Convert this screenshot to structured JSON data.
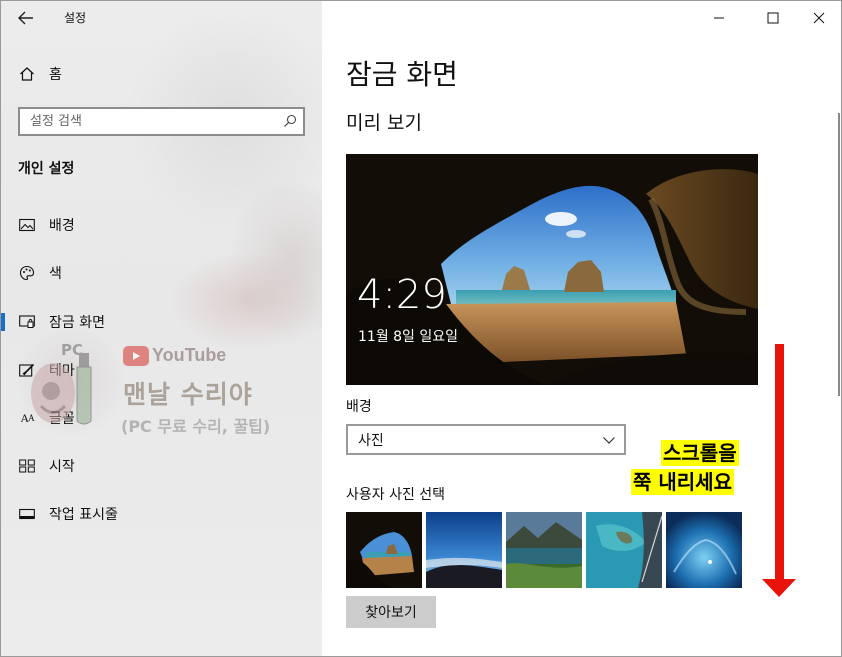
{
  "window": {
    "app_title": "설정",
    "back_icon": "back-arrow-icon",
    "controls": {
      "minimize": "minimize-icon",
      "maximize": "maximize-icon",
      "close": "close-icon"
    }
  },
  "sidebar": {
    "home_label": "홈",
    "search_placeholder": "설정 검색",
    "section_title": "개인 설정",
    "items": [
      {
        "label": "배경",
        "icon": "picture-icon",
        "active": false
      },
      {
        "label": "색",
        "icon": "palette-icon",
        "active": false
      },
      {
        "label": "잠금 화면",
        "icon": "lock-screen-icon",
        "active": true
      },
      {
        "label": "테마",
        "icon": "theme-brush-icon",
        "active": false
      },
      {
        "label": "글꼴",
        "icon": "font-icon",
        "active": false
      },
      {
        "label": "시작",
        "icon": "start-grid-icon",
        "active": false
      },
      {
        "label": "작업 표시줄",
        "icon": "taskbar-icon",
        "active": false
      }
    ],
    "accent_color": "#1a6dc8"
  },
  "watermark": {
    "pc": "PC",
    "youtube": "YouTube",
    "main": "맨날 수리야",
    "sub": "(PC 무료 수리, 꿀팁)"
  },
  "main": {
    "page_title": "잠금 화면",
    "preview_heading": "미리 보기",
    "preview_time": "4:29",
    "preview_date": "11월 8일 일요일",
    "background_label": "배경",
    "background_value": "사진",
    "choose_label": "사용자 사진 선택",
    "browse_label": "찾아보기"
  },
  "annotation": {
    "line1": "스크롤을",
    "line2": "쭉 내리세요",
    "arrow_color": "#e8140b",
    "highlight_color": "#ffff00"
  }
}
